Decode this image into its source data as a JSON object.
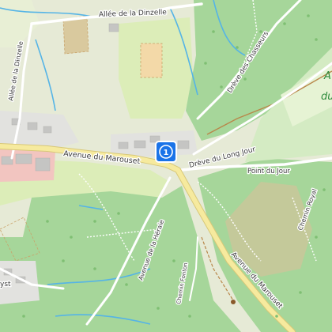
{
  "map": {
    "streets": {
      "allee_dinzelle": "Allée de la Dinzelle",
      "allee_dinzelle_vertical": "Allée de la Dinzelle",
      "avenue_marouset_top": "Avenue du Marouset",
      "avenue_marouset_bottom": "Avenue du Marouset",
      "dreve_chasseurs": "Drève des Chasseurs",
      "dreve_long_jour": "Drève du Long Jour",
      "point_du_jour": "Point du Jour",
      "chemin_royal": "Chemin Royal",
      "avenue_herale": "Avenue de la Héraie",
      "chemin_fonton": "Chemin Fonton",
      "edge_left": "yst"
    },
    "area_labels": {
      "forest_a": "A",
      "forest_du": "du"
    },
    "marker": {
      "number": "1",
      "color": "#1a73e8"
    },
    "colors": {
      "forest": "#9ccf8f",
      "field": "#e3f0c4",
      "road_main": "#f4e7a1",
      "water": "#4fb0e0",
      "building": "#c9c9c9",
      "red_zone": "#f3c0c0"
    }
  }
}
